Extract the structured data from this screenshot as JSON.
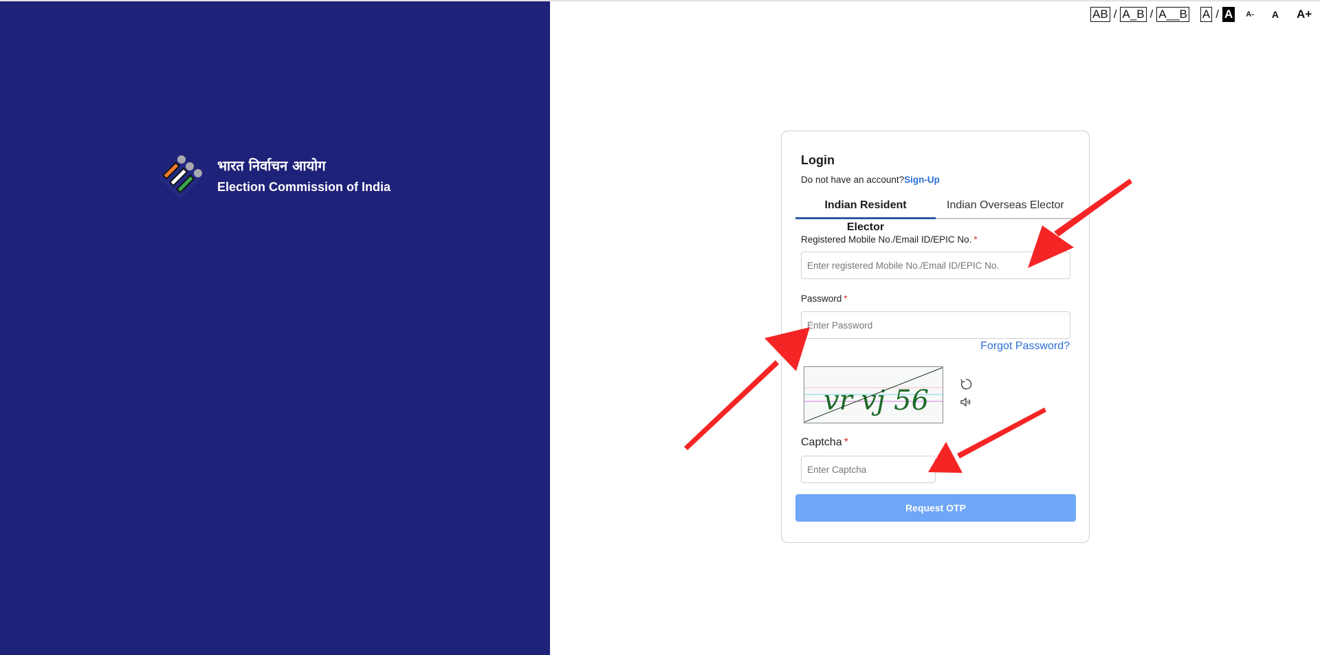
{
  "accessibility_bar": {
    "spacing_options": [
      "AB",
      "A_B",
      "A__B"
    ],
    "contrast_options": [
      "A",
      "A"
    ],
    "font_sizes": [
      "A-",
      "A",
      "A+"
    ],
    "separator": "/"
  },
  "brand": {
    "hindi_name": "भारत निर्वाचन आयोग",
    "english_name": "Election Commission of India",
    "logo_colors": {
      "saffron": "#f47c2a",
      "white": "#ffffff",
      "green": "#3aa64a",
      "dots": "#a8a8b0"
    }
  },
  "login": {
    "title": "Login",
    "no_account_text": "Do not have an account?",
    "signup_link": "Sign-Up",
    "tabs": [
      {
        "label": "Indian Resident Elector",
        "active": true
      },
      {
        "label": "Indian Overseas Elector",
        "active": false
      }
    ],
    "fields": {
      "identifier": {
        "label": "Registered Mobile No./Email ID/EPIC No.",
        "required_mark": "*",
        "placeholder": "Enter registered Mobile No./Email ID/EPIC No.",
        "value": ""
      },
      "password": {
        "label": "Password",
        "required_mark": "*",
        "placeholder": "Enter Password",
        "value": ""
      },
      "captcha": {
        "label": "Captcha",
        "required_mark": "*",
        "placeholder": "Enter Captcha",
        "value": ""
      }
    },
    "forgot_password": "Forgot Password?",
    "captcha_image_text": "vr vj 56",
    "captcha_actions": [
      "refresh-icon",
      "audio-icon"
    ],
    "submit_button": "Request OTP"
  },
  "colors": {
    "left_panel": "#1e2278",
    "link": "#2b6fd6",
    "button": "#6fa6f7",
    "tab_active_underline": "#2c5aa0",
    "required": "#d32f2f",
    "annotation_arrow": "#f52525"
  }
}
